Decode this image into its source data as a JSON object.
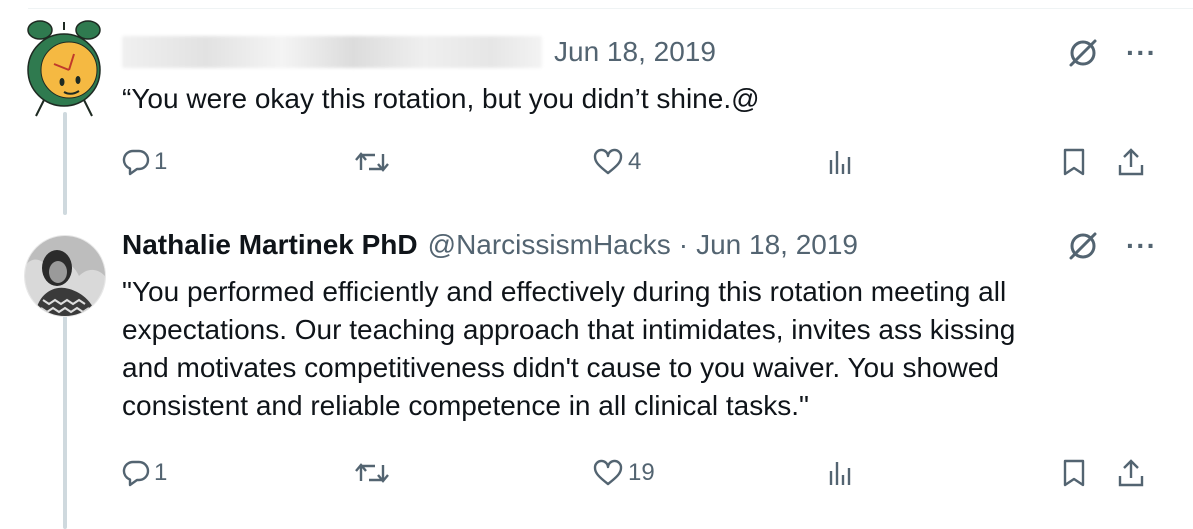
{
  "tweets": [
    {
      "author_name": "",
      "handle": "",
      "date": "Jun 18, 2019",
      "avatar_icon": "alarm-clock-smiley-icon",
      "text": "“You were okay this rotation, but you didn’t shine.@",
      "replies": "1",
      "retweets": "",
      "likes": "4",
      "views": ""
    },
    {
      "author_name": "Nathalie Martinek PhD",
      "handle": "@NarcissismHacks",
      "separator": "·",
      "date": "Jun 18, 2019",
      "avatar_icon": "profile-photo-avatar",
      "text": "\"You performed efficiently and effectively during this rotation meeting all\nexpectations. Our teaching approach that intimidates, invites ass kissing\nand motivates competitiveness didn't cause to you waiver. You showed\nconsistent and reliable competence in all clinical tasks.\"",
      "replies": "1",
      "retweets": "",
      "likes": "19",
      "views": ""
    }
  ],
  "icons": {
    "grok": "grok-icon",
    "more": "more-icon",
    "reply": "reply-icon",
    "retweet": "retweet-icon",
    "like": "heart-icon",
    "views": "views-bar-chart-icon",
    "bookmark": "bookmark-icon",
    "share": "share-icon"
  },
  "colors": {
    "text_primary": "#0f1419",
    "text_secondary": "#536471",
    "thread_line": "#cfd9de",
    "clock_green": "#2f7a4f",
    "clock_face": "#f5b942"
  }
}
